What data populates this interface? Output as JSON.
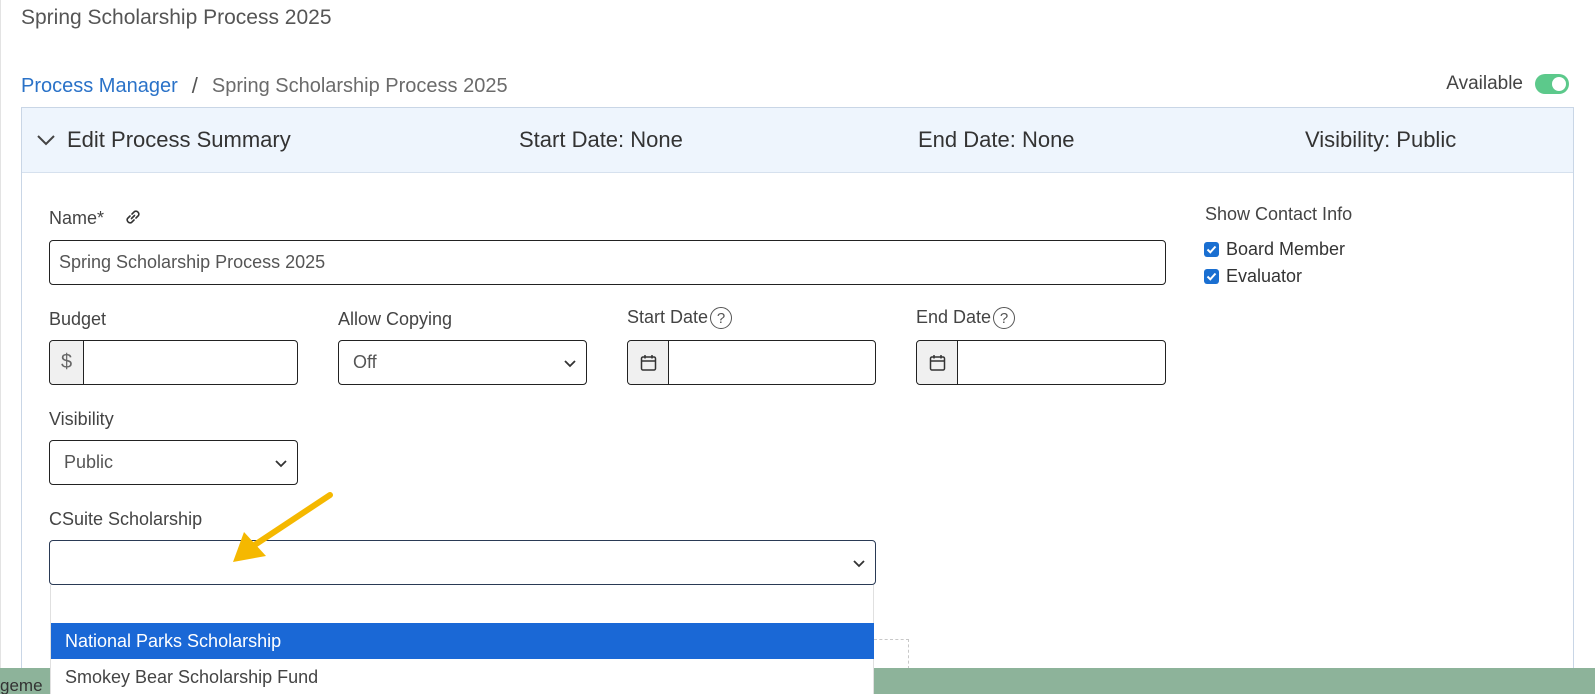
{
  "page": {
    "title": "Spring Scholarship Process 2025"
  },
  "breadcrumb": {
    "link": "Process Manager",
    "separator": "/",
    "current": "Spring Scholarship Process 2025"
  },
  "availability": {
    "label": "Available",
    "enabled": true
  },
  "summary": {
    "title": "Edit Process Summary",
    "start_date": "Start Date: None",
    "end_date": "End Date: None",
    "visibility": "Visibility: Public"
  },
  "form": {
    "name_label": "Name*",
    "name_value": "Spring Scholarship Process 2025",
    "budget_label": "Budget",
    "budget_prefix": "$",
    "budget_value": "",
    "allow_copying_label": "Allow Copying",
    "allow_copying_value": "Off",
    "start_date_label": "Start Date",
    "start_date_value": "",
    "end_date_label": "End Date",
    "end_date_value": "",
    "help_glyph": "?",
    "visibility_label": "Visibility",
    "visibility_value": "Public",
    "csuite_label": "CSuite Scholarship",
    "csuite_value": ""
  },
  "contact_info": {
    "label": "Show Contact Info",
    "options": [
      {
        "label": "Board Member",
        "checked": true
      },
      {
        "label": "Evaluator",
        "checked": true
      }
    ]
  },
  "dropdown": {
    "options": [
      {
        "label": "National Parks Scholarship",
        "selected": true
      },
      {
        "label": "Smokey Bear Scholarship Fund",
        "selected": false
      }
    ]
  },
  "footer": {
    "text": "geme"
  },
  "colors": {
    "link": "#2a72c8",
    "toggle_on": "#5cc98b",
    "selected_option": "#1a68d6",
    "arrow": "#f5b800",
    "footer": "#8db39a"
  }
}
